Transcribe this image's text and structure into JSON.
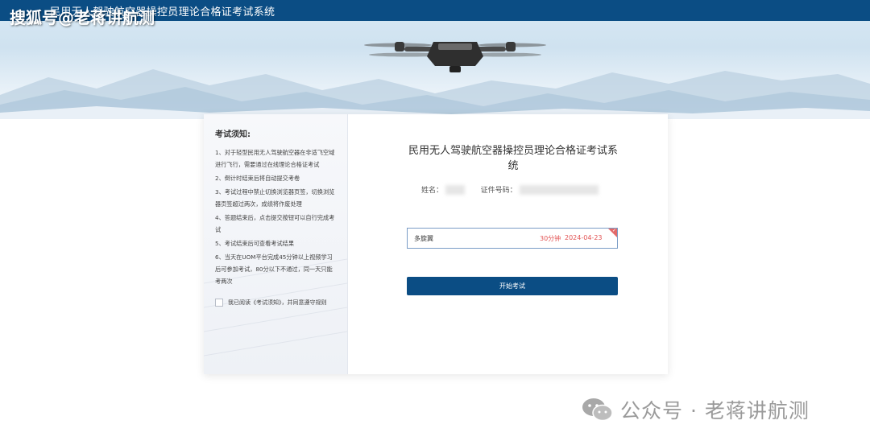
{
  "header": {
    "system_title": "民用无人驾驶航空器操控员理论合格证考试系统"
  },
  "watermarks": {
    "top_left": "搜狐号@老蒋讲航测",
    "bottom_right": "公众号 · 老蒋讲航测",
    "bottom_icon": "wechat-icon"
  },
  "notice": {
    "title": "考试须知:",
    "items": [
      "1、对于轻型民用无人驾驶航空器在非适飞空域进行飞行，需要通过在线理论合格证考试",
      "2、倒计时结束后将自动提交考卷",
      "3、考试过程中禁止切换浏览器页签，切换浏览器页签超过两次，成绩将作废处理",
      "4、答题结束后，点击提交按钮可以自行完成考试",
      "5、考试结束后可查看考试结果",
      "6、当天在UOM平台完成45分钟以上视频学习后可参加考试，80分以下不通过，同一天只能考两次"
    ],
    "agree_label": "我已阅读《考试须知》，并同意遵守规则",
    "agree_checked": false
  },
  "main": {
    "title": "民用无人驾驶航空器操控员理论合格证考试系统",
    "name_label": "姓名：",
    "id_label": "证件号码：",
    "exam": {
      "name": "多旋翼",
      "duration": "30分钟",
      "date": "2024-04-23",
      "selected": true
    },
    "start_button": "开始考试"
  },
  "colors": {
    "primary": "#0b4d84",
    "accent_red": "#e25252",
    "selected_border": "#7a9cc6"
  }
}
